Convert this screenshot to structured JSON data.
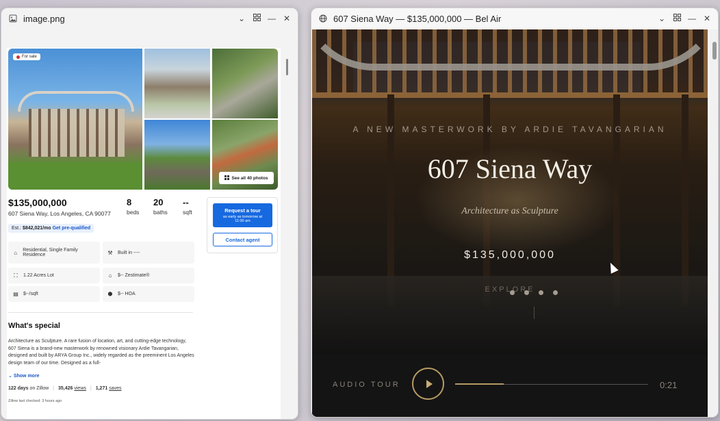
{
  "left_window": {
    "title": "image.png",
    "icon": "image-file-icon",
    "controls": [
      "chevron-down-icon",
      "grid-icon",
      "minimize-icon",
      "close-icon"
    ]
  },
  "listing": {
    "badge": "For sale",
    "see_all": "See all 40 photos",
    "price": "$135,000,000",
    "address": "607 Siena Way, Los Angeles, CA 90077",
    "beds": {
      "value": "8",
      "label": "beds"
    },
    "baths": {
      "value": "20",
      "label": "baths"
    },
    "sqft": {
      "value": "--",
      "label": "sqft"
    },
    "estimate": {
      "prefix": "Est.:",
      "amount": "$842,021/mo",
      "link": "Get pre-qualified"
    },
    "tour": {
      "title": "Request a tour",
      "subtitle": "as early as tomorrow at 11:00 am"
    },
    "contact": "Contact agent",
    "facts": [
      {
        "icon": "home-icon",
        "text": "Residential, Single Family Residence"
      },
      {
        "icon": "hammer-icon",
        "text": "Built in ----"
      },
      {
        "icon": "lot-icon",
        "text": "1.22 Acres Lot"
      },
      {
        "icon": "zestimate-icon",
        "text": "$-- Zestimate®"
      },
      {
        "icon": "ruler-icon",
        "text": "$--/sqft"
      },
      {
        "icon": "hoa-icon",
        "text": "$-- HOA"
      }
    ],
    "whats_special_title": "What's special",
    "whats_special_body": "Architecture as Sculpture. A rare fusion of location, art, and cutting-edge technology, 607 Siena is a brand-new masterwork by renowned visionary Ardie Tavangarian, designed and built by ARYA Group Inc., widely regarded as the preeminent Los Angeles design team of our time. Designed as a full-",
    "show_more": "Show more",
    "days": "122 days",
    "days_suffix": "on Zillow",
    "views": "35,426",
    "views_label": "views",
    "saves": "1,271",
    "saves_label": "saves",
    "last_checked": "Zillow last checked: 3 hours ago"
  },
  "right_window": {
    "title": "607 Siena Way — $135,000,000 — Bel Air",
    "icon": "globe-icon",
    "controls": [
      "chevron-down-icon",
      "grid-icon",
      "minimize-icon",
      "close-icon"
    ]
  },
  "hero": {
    "tagline": "A NEW MASTERWORK BY ARDIE TAVANGARIAN",
    "name": "607 Siena Way",
    "subtitle": "Architecture as Sculpture",
    "price": "$135,000,000",
    "explore": "EXPLORE",
    "slide_count": 4
  },
  "audio": {
    "label": "AUDIO TOUR",
    "time": "0:21",
    "progress": 0.25
  },
  "colors": {
    "zillow_blue": "#1769e0",
    "accent_gold": "#b69a63",
    "badge_red": "#d0342c"
  }
}
